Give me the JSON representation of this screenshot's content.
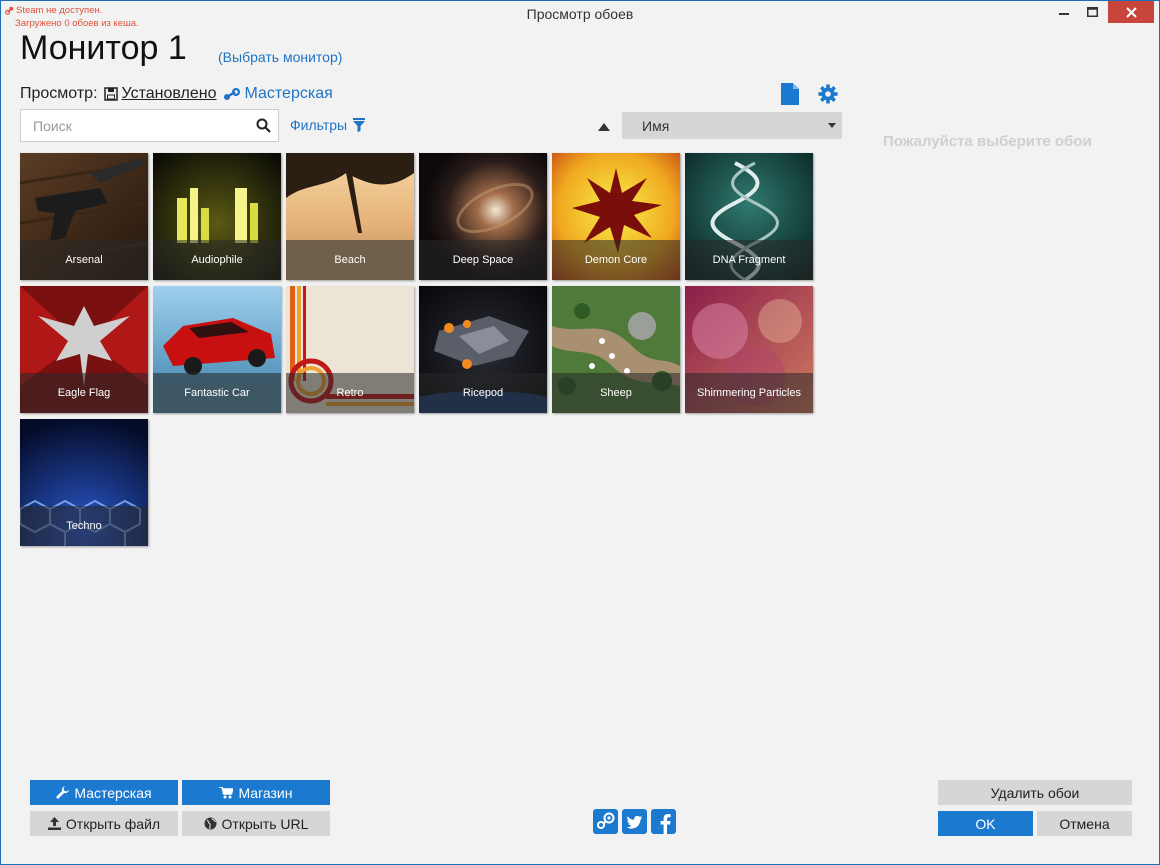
{
  "window": {
    "title": "Просмотр обоев",
    "status_line1": "Steam не доступен.",
    "status_line2": "Загружено 0 обоев из кеша."
  },
  "header": {
    "monitor_title": "Монитор 1",
    "select_monitor": "(Выбрать монитор)",
    "view_label": "Просмотр:",
    "installed": "Установлено",
    "workshop": "Мастерская"
  },
  "search": {
    "placeholder": "Поиск",
    "value": ""
  },
  "filters_label": "Фильтры",
  "sort": {
    "selected": "Имя"
  },
  "right_panel": {
    "placeholder": "Пожалуйста выберите обои"
  },
  "wallpapers": [
    {
      "name": "Arsenal"
    },
    {
      "name": "Audiophile"
    },
    {
      "name": "Beach"
    },
    {
      "name": "Deep Space"
    },
    {
      "name": "Demon Core"
    },
    {
      "name": "DNA Fragment"
    },
    {
      "name": "Eagle Flag"
    },
    {
      "name": "Fantastic Car"
    },
    {
      "name": "Retro"
    },
    {
      "name": "Ricepod"
    },
    {
      "name": "Sheep"
    },
    {
      "name": "Shimmering Particles"
    },
    {
      "name": "Techno"
    }
  ],
  "footer": {
    "workshop_btn": "Мастерская",
    "shop_btn": "Магазин",
    "open_file_btn": "Открыть файл",
    "open_url_btn": "Открыть URL",
    "delete_btn": "Удалить обои",
    "ok_btn": "OK",
    "cancel_btn": "Отмена"
  },
  "colors": {
    "accent": "#1c79d0",
    "link": "#1f74c4",
    "status": "#e0503a",
    "close": "#c7453b"
  },
  "icons": [
    "steam-icon",
    "save-icon",
    "document-icon",
    "gear-icon",
    "search-icon",
    "filter-icon",
    "wrench-icon",
    "cart-icon",
    "upload-icon",
    "globe-icon",
    "twitter-icon",
    "facebook-icon"
  ]
}
